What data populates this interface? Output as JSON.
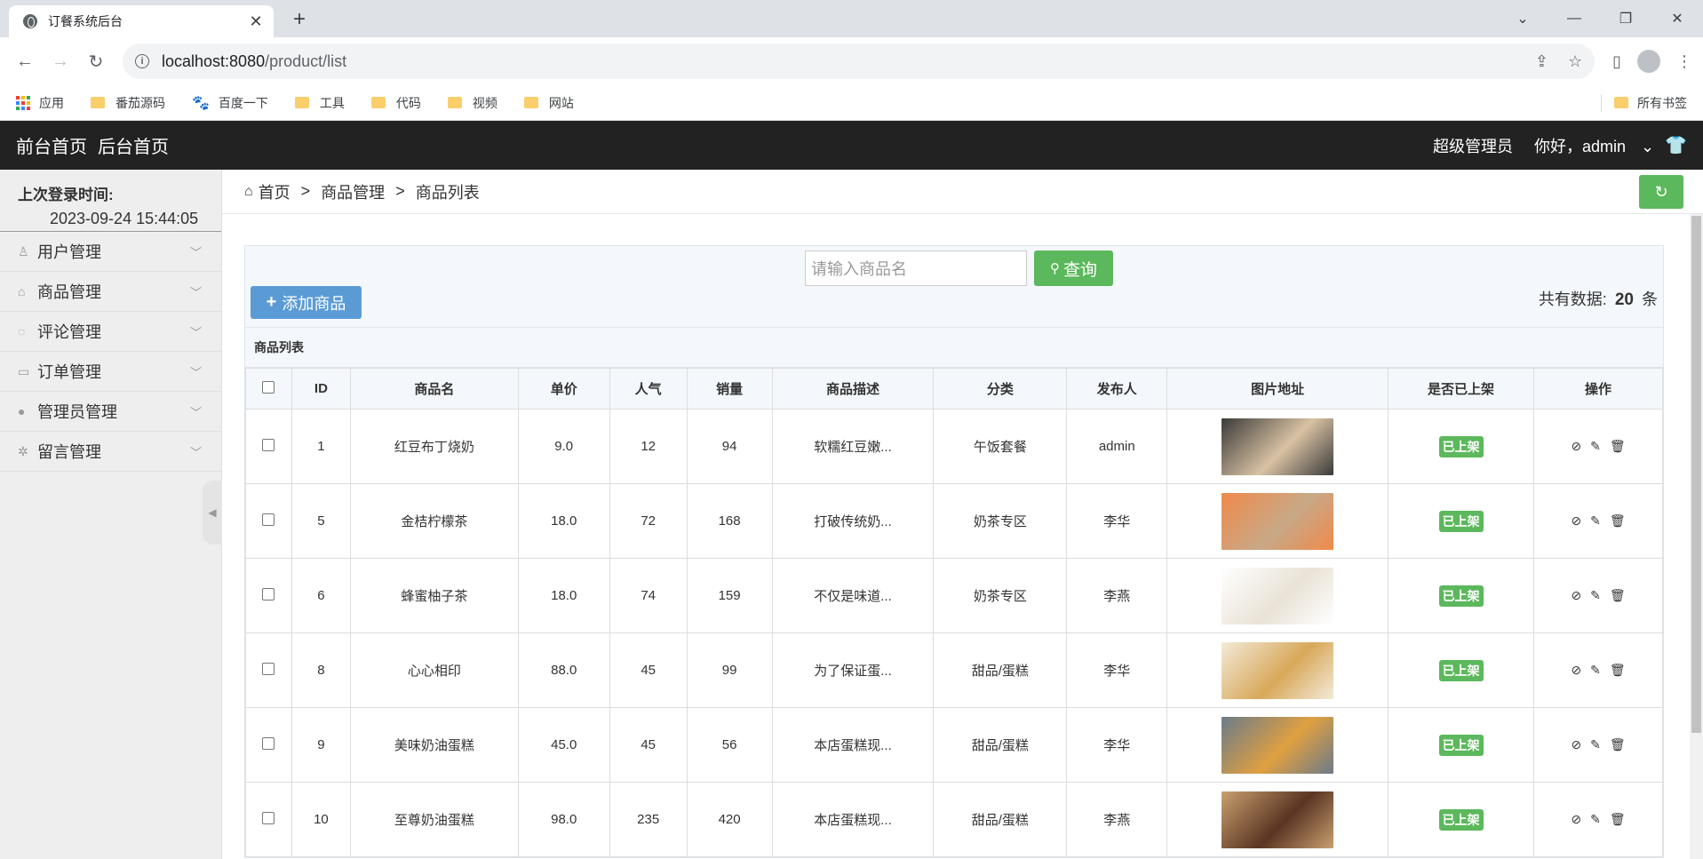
{
  "browser": {
    "tab_title": "订餐系统后台",
    "url_host": "localhost:8080",
    "url_path": "/product/list",
    "bookmarks": [
      "应用",
      "番茄源码",
      "百度一下",
      "工具",
      "代码",
      "视频",
      "网站"
    ],
    "bookmarks_right": "所有书签"
  },
  "header": {
    "nav1": "前台首页",
    "nav2": "后台首页",
    "role": "超级管理员",
    "greeting": "你好，admin"
  },
  "sidebar": {
    "login_label": "上次登录时间:",
    "login_time": "2023-09-24 15:44:05",
    "items": [
      {
        "label": "用户管理",
        "icon": "user-icon"
      },
      {
        "label": "商品管理",
        "icon": "bag-icon"
      },
      {
        "label": "评论管理",
        "icon": "comment-icon"
      },
      {
        "label": "订单管理",
        "icon": "card-icon"
      },
      {
        "label": "管理员管理",
        "icon": "admin-icon"
      },
      {
        "label": "留言管理",
        "icon": "gear-icon"
      }
    ]
  },
  "breadcrumb": {
    "home": "首页",
    "level1": "商品管理",
    "level2": "商品列表"
  },
  "search": {
    "placeholder": "请输入商品名",
    "button": "查询",
    "add_button": "添加商品",
    "total_prefix": "共有数据:",
    "total_count": "20",
    "total_suffix": "条"
  },
  "table": {
    "title": "商品列表",
    "columns": [
      "ID",
      "商品名",
      "单价",
      "人气",
      "销量",
      "商品描述",
      "分类",
      "发布人",
      "图片地址",
      "是否已上架",
      "操作"
    ],
    "rows": [
      {
        "id": "1",
        "name": "红豆布丁烧奶",
        "price": "9.0",
        "popularity": "12",
        "sales": "94",
        "desc": "软糯红豆嫩...",
        "category": "午饭套餐",
        "publisher": "admin",
        "status": "已上架",
        "img_colors": [
          "#3a3a3a",
          "#d9c2a3"
        ]
      },
      {
        "id": "5",
        "name": "金桔柠檬茶",
        "price": "18.0",
        "popularity": "72",
        "sales": "168",
        "desc": "打破传统奶...",
        "category": "奶茶专区",
        "publisher": "李华",
        "status": "已上架",
        "img_colors": [
          "#f08a4b",
          "#c8a887"
        ]
      },
      {
        "id": "6",
        "name": "蜂蜜柚子茶",
        "price": "18.0",
        "popularity": "74",
        "sales": "159",
        "desc": "不仅是味道...",
        "category": "奶茶专区",
        "publisher": "李燕",
        "status": "已上架",
        "img_colors": [
          "#ffffff",
          "#e9e2d6"
        ]
      },
      {
        "id": "8",
        "name": "心心相印",
        "price": "88.0",
        "popularity": "45",
        "sales": "99",
        "desc": "为了保证蛋...",
        "category": "甜品/蛋糕",
        "publisher": "李华",
        "status": "已上架",
        "img_colors": [
          "#f3ead8",
          "#d8a85a"
        ]
      },
      {
        "id": "9",
        "name": "美味奶油蛋糕",
        "price": "45.0",
        "popularity": "45",
        "sales": "56",
        "desc": "本店蛋糕现...",
        "category": "甜品/蛋糕",
        "publisher": "李华",
        "status": "已上架",
        "img_colors": [
          "#6b7b8a",
          "#e0a040"
        ]
      },
      {
        "id": "10",
        "name": "至尊奶油蛋糕",
        "price": "98.0",
        "popularity": "235",
        "sales": "420",
        "desc": "本店蛋糕现...",
        "category": "甜品/蛋糕",
        "publisher": "李燕",
        "status": "已上架",
        "img_colors": [
          "#c9a070",
          "#5a3422"
        ]
      }
    ]
  }
}
